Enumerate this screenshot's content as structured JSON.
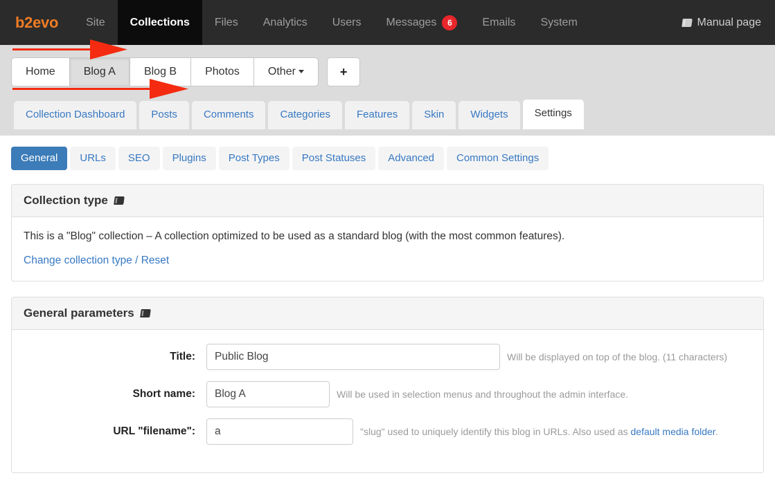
{
  "topbar": {
    "brand": "b2evo",
    "items": [
      {
        "label": "Site",
        "active": false
      },
      {
        "label": "Collections",
        "active": true
      },
      {
        "label": "Files",
        "active": false
      },
      {
        "label": "Analytics",
        "active": false
      },
      {
        "label": "Users",
        "active": false
      },
      {
        "label": "Messages",
        "active": false,
        "badge": "6"
      },
      {
        "label": "Emails",
        "active": false
      },
      {
        "label": "System",
        "active": false
      }
    ],
    "manual_page": "Manual page",
    "badge_color": "#e8262b",
    "brand_color": "#f07c23"
  },
  "collection_tabs": {
    "items": [
      {
        "label": "Home",
        "active": false
      },
      {
        "label": "Blog A",
        "active": true
      },
      {
        "label": "Blog B",
        "active": false
      },
      {
        "label": "Photos",
        "active": false
      },
      {
        "label": "Other",
        "active": false,
        "dropdown": true
      }
    ],
    "add_label": "+"
  },
  "section_tabs": {
    "items": [
      {
        "label": "Collection Dashboard",
        "active": false
      },
      {
        "label": "Posts",
        "active": false
      },
      {
        "label": "Comments",
        "active": false
      },
      {
        "label": "Categories",
        "active": false
      },
      {
        "label": "Features",
        "active": false
      },
      {
        "label": "Skin",
        "active": false
      },
      {
        "label": "Widgets",
        "active": false
      },
      {
        "label": "Settings",
        "active": true
      }
    ]
  },
  "sub_tabs": {
    "active_color": "#3c7cb8",
    "items": [
      {
        "label": "General",
        "active": true
      },
      {
        "label": "URLs",
        "active": false
      },
      {
        "label": "SEO",
        "active": false
      },
      {
        "label": "Plugins",
        "active": false
      },
      {
        "label": "Post Types",
        "active": false
      },
      {
        "label": "Post Statuses",
        "active": false
      },
      {
        "label": "Advanced",
        "active": false
      },
      {
        "label": "Common Settings",
        "active": false
      }
    ]
  },
  "collection_type_panel": {
    "title": "Collection type",
    "description": "This is a \"Blog\" collection – A collection optimized to be used as a standard blog (with the most common features).",
    "change_link": "Change collection type / Reset"
  },
  "general_parameters_panel": {
    "title": "General parameters",
    "fields": [
      {
        "label": "Title:",
        "value": "Public Blog",
        "help": "Will be displayed on top of the blog. (11 characters)"
      },
      {
        "label": "Short name:",
        "value": "Blog A",
        "help": "Will be used in selection menus and throughout the admin interface."
      },
      {
        "label": "URL \"filename\":",
        "value": "a",
        "help_before": "\"slug\" used to uniquely identify this blog in URLs. Also used as ",
        "help_link": "default media folder",
        "help_after": "."
      }
    ]
  },
  "annotations": {
    "arrow_color": "#f42b10",
    "arrows": [
      {
        "points_to": "Title:"
      },
      {
        "points_to": "Short name:"
      }
    ]
  }
}
